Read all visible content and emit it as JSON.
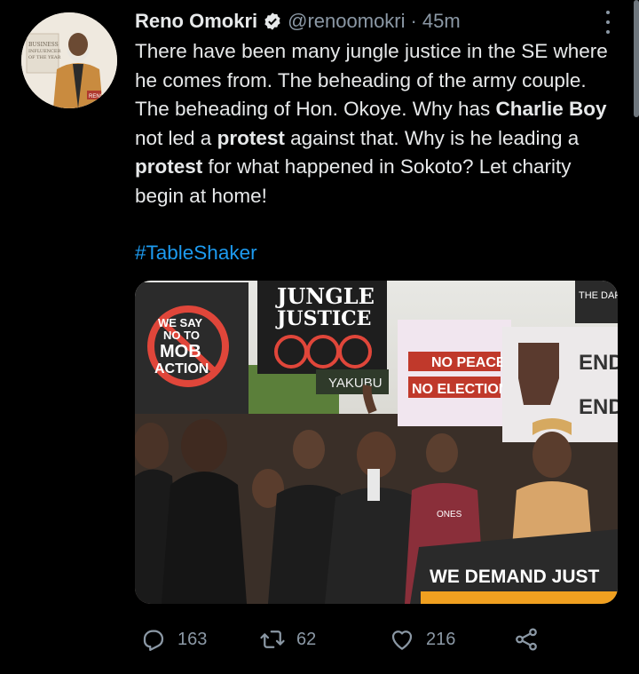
{
  "author": {
    "name": "Reno Omokri",
    "handle": "@renoomokri",
    "separator": "·",
    "time": "45m",
    "avatar_text": [
      "BUSINESS",
      "INFLUENCER",
      "OF THE YEAR"
    ],
    "avatar_badge": "RENO"
  },
  "tweet": {
    "segments": [
      {
        "text": "There have been many jungle justice in the SE where he comes from. The beheading of the army couple. The beheading of Hon. Okoye. Why has ",
        "bold": false
      },
      {
        "text": "Charlie Boy",
        "bold": true
      },
      {
        "text": " not led a ",
        "bold": false
      },
      {
        "text": "protest",
        "bold": true
      },
      {
        "text": " against that. Why is he leading a ",
        "bold": false
      },
      {
        "text": "protest",
        "bold": true
      },
      {
        "text": " for what happened in Sokoto? Let charity begin at home!",
        "bold": false
      }
    ],
    "hashtag": "#TableShaker"
  },
  "media": {
    "signs": {
      "mob_action": [
        "WE SAY",
        "NO TO",
        "MOB",
        "ACTION"
      ],
      "jungle_justice": [
        "JUNGLE",
        "JUSTICE"
      ],
      "yakubu": "YAKUBU",
      "no_peace": "NO PEACE",
      "no_election": "NO ELECTION",
      "end_1": "END",
      "end_2": "END",
      "dark": "THE DAR",
      "demand": "WE DEMAND JUST",
      "jones": "ONES"
    }
  },
  "actions": {
    "replies": "163",
    "retweets": "62",
    "likes": "216"
  },
  "colors": {
    "background": "#000000",
    "text": "#e7e9ea",
    "secondary": "#8b98a5",
    "link": "#1d9bf0",
    "verified": "#1d9bf0"
  }
}
